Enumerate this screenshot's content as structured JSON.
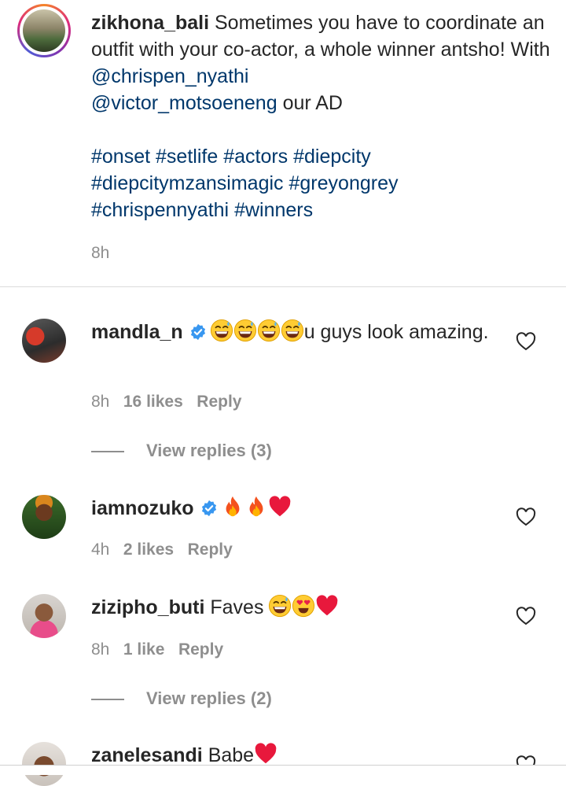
{
  "post": {
    "username": "zikhona_bali",
    "caption_text": "Sometimes you have to coordinate an outfit with your co-actor, a whole winner antsho! With",
    "mention1": "@chrispen_nyathi",
    "mention2": "@victor_motsoeneng",
    "caption_tail": "our AD",
    "hashtags": [
      "#onset",
      "#setlife",
      "#actors",
      "#diepcity",
      "#diepcitymzansimagic",
      "#greyongrey",
      "#chrispennyathi",
      "#winners"
    ],
    "time": "8h"
  },
  "comments": [
    {
      "username": "mandla_n",
      "verified": true,
      "text": "u guys look amazing.",
      "emojis": [
        "grinning-sweat-face",
        "grinning-sweat-face",
        "grinning-sweat-face",
        "grinning-sweat-face"
      ],
      "time": "8h",
      "likes": "16 likes",
      "reply": "Reply",
      "view_replies": "View replies (3)"
    },
    {
      "username": "iamnozuko",
      "verified": true,
      "text": "",
      "emojis": [
        "fire",
        "fire",
        "red-heart"
      ],
      "time": "4h",
      "likes": "2 likes",
      "reply": "Reply"
    },
    {
      "username": "zizipho_buti",
      "verified": false,
      "text": "Faves",
      "emojis": [
        "grinning-sweat-face",
        "heart-eyes-face",
        "red-heart"
      ],
      "time": "8h",
      "likes": "1 like",
      "reply": "Reply",
      "view_replies": "View replies (2)"
    },
    {
      "username": "zanelesandi",
      "verified": false,
      "text": "Babe",
      "emojis": [
        "red-heart"
      ]
    }
  ],
  "colors": {
    "text": "#262626",
    "secondary": "#8e8e8e",
    "link": "#00376b",
    "verified": "#3897f0",
    "divider": "#dbdbdb"
  }
}
